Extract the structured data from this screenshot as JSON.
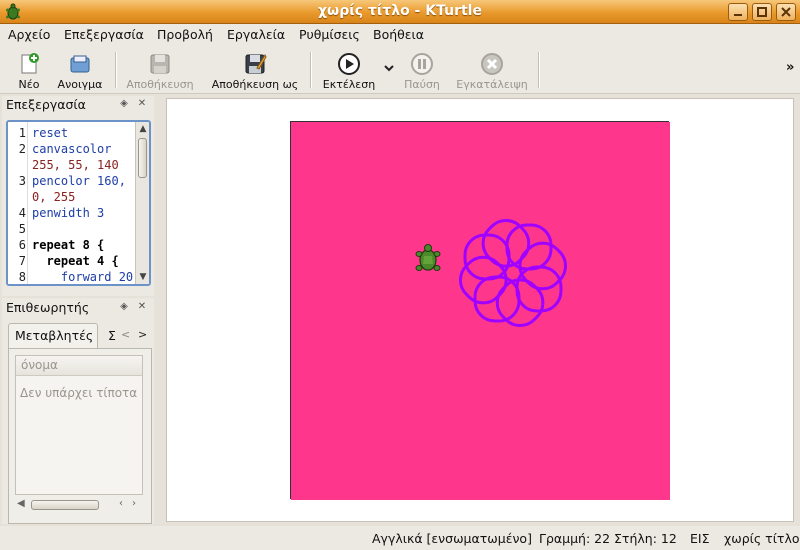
{
  "window": {
    "title": "χωρίς τίτλο - KTurtle",
    "icon": "turtle-icon",
    "buttons": [
      "minimize-icon",
      "maximize-icon",
      "close-icon"
    ]
  },
  "menubar": {
    "items": [
      "Αρχείο",
      "Επεξεργασία",
      "Προβολή",
      "Εργαλεία",
      "Ρυθμίσεις",
      "Βοήθεια"
    ]
  },
  "toolbar": {
    "new": {
      "label": "Νέο",
      "icon": "new-file-icon"
    },
    "open": {
      "label": "Ανοιγμα",
      "icon": "open-icon"
    },
    "save": {
      "label": "Αποθήκευση",
      "icon": "save-icon",
      "enabled": false
    },
    "save_as": {
      "label": "Αποθήκευση ως",
      "icon": "save-as-icon"
    },
    "run": {
      "label": "Εκτέλεση",
      "icon": "play-icon"
    },
    "pause": {
      "label": "Παύση",
      "icon": "pause-icon",
      "enabled": false
    },
    "abort": {
      "label": "Εγκατάλειψη",
      "icon": "abort-icon",
      "enabled": false
    },
    "overflow": "»"
  },
  "editor_dock": {
    "title": "Επεξεργασία",
    "lines": [
      {
        "n": "1",
        "text": "reset"
      },
      {
        "n": "2",
        "text": "canvascolor"
      },
      {
        "n": "",
        "text": "255, 55, 140"
      },
      {
        "n": "3",
        "text": "pencolor 160,"
      },
      {
        "n": "",
        "text": "0, 255"
      },
      {
        "n": "4",
        "text": "penwidth 3"
      },
      {
        "n": "5",
        "text": ""
      },
      {
        "n": "6",
        "text": "repeat 8 {"
      },
      {
        "n": "7",
        "text": "  repeat 4 {"
      },
      {
        "n": "8",
        "text": "    forward 20"
      }
    ]
  },
  "inspector_dock": {
    "title": "Επιθεωρητής",
    "tabs": [
      "Μεταβλητές",
      "Σ"
    ],
    "column_header": "όνομα",
    "empty_text": "Δεν υπάρχει τίποτα"
  },
  "canvas": {
    "background_color": "#ff378c",
    "pen_color": "#a000ff",
    "pen_width": 3
  },
  "statusbar": {
    "language": "Αγγλικά [ενσωματωμένο]",
    "position": "Γραμμή: 22 Στήλη: 12",
    "mode": "ΕΙΣ",
    "filename": "χωρίς τίτλο"
  }
}
